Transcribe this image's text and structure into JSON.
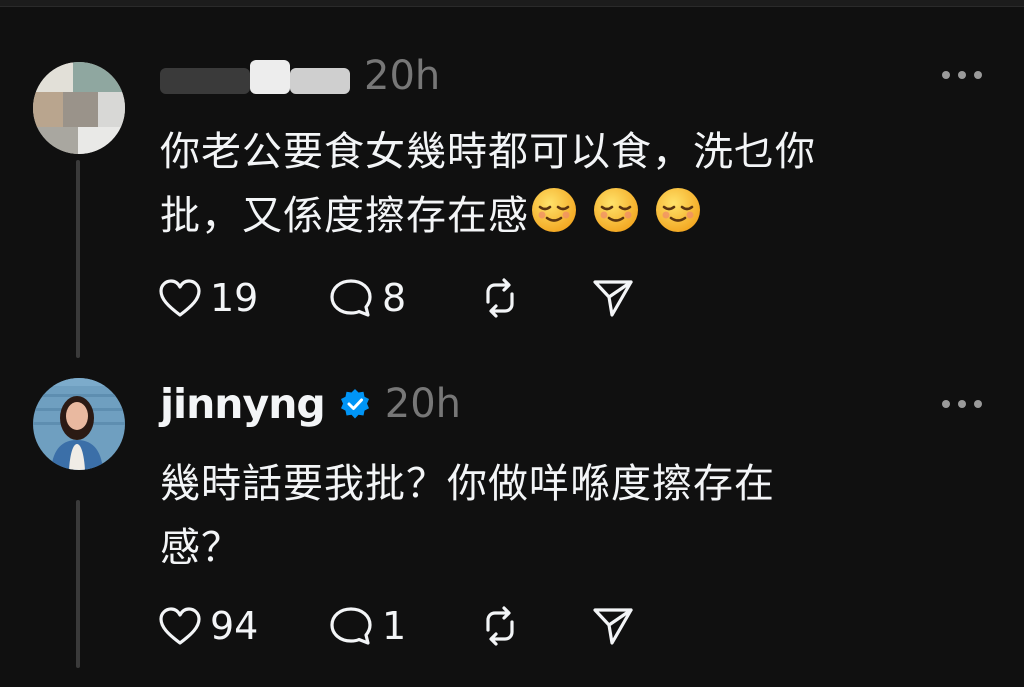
{
  "posts": [
    {
      "username": "",
      "time": "20h",
      "text_lines": [
        "你老公要食女幾時都可以食，洗乜你",
        "批，又係度擦存在感"
      ],
      "emoji_count": 3,
      "emoji_name": "relieved-face-icon",
      "likes": "19",
      "replies": "8"
    },
    {
      "username": "jinnyng",
      "verified": true,
      "time": "20h",
      "text_lines": [
        "幾時話要我批？你做咩喺度擦存在",
        "感？"
      ],
      "likes": "94",
      "replies": "1"
    }
  ],
  "colors": {
    "background": "#101010",
    "text": "#f3f5f7",
    "muted": "#777777",
    "verified": "#0095f6",
    "thread_line": "#3a3a3a"
  },
  "icons": [
    "heart-icon",
    "comment-icon",
    "repost-icon",
    "share-icon",
    "more-icon",
    "verified-badge-icon"
  ]
}
